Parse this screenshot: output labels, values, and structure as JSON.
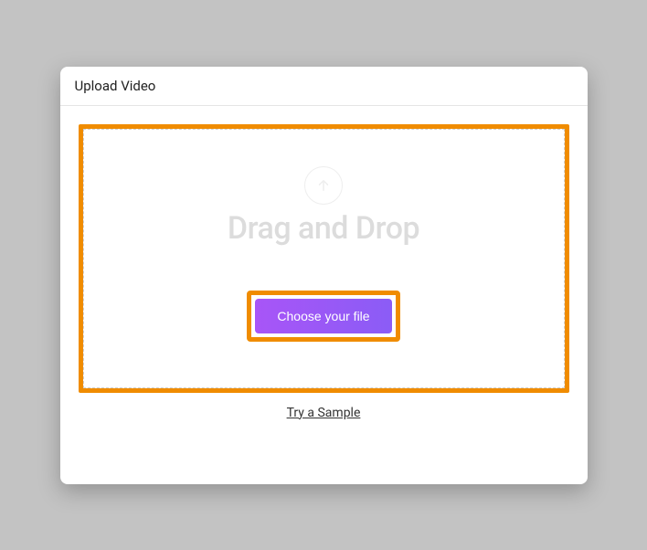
{
  "modal": {
    "title": "Upload Video"
  },
  "dropzone": {
    "heading": "Drag and Drop",
    "choose_button": "Choose your file"
  },
  "sample_link": "Try a Sample",
  "colors": {
    "highlight": "#f08c00",
    "button_gradient_start": "#a855f7",
    "button_gradient_end": "#8b5cf6"
  }
}
